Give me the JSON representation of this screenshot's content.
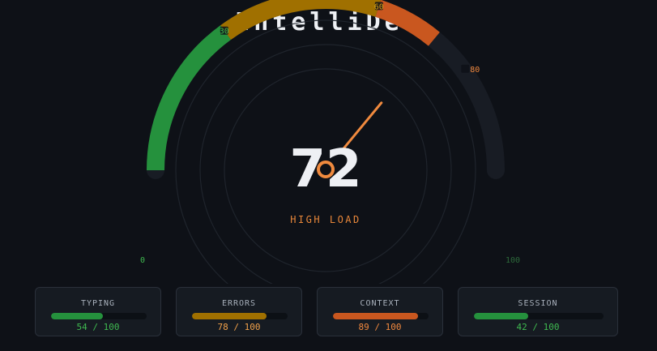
{
  "app": {
    "title": "IntelliDev"
  },
  "gauge": {
    "value": 72,
    "display_value": "72",
    "status": "HIGH LOAD",
    "min": 0,
    "max": 100,
    "labels": [
      "0",
      "30",
      "60",
      "80",
      "100"
    ],
    "zones": [
      {
        "from": 0,
        "to": 30,
        "color": "#25913d"
      },
      {
        "from": 30,
        "to": 60,
        "color": "#a07000"
      },
      {
        "from": 60,
        "to": 72,
        "color": "#c9571f"
      }
    ],
    "track_color": "#181c24",
    "needle_color": "#f08a3e"
  },
  "cards": [
    {
      "label": "TYPING",
      "value": 54,
      "max": 100,
      "value_text": "54 / 100",
      "color": "#25913d",
      "text_color": "#3fb950"
    },
    {
      "label": "ERRORS",
      "value": 78,
      "max": 100,
      "value_text": "78 / 100",
      "color": "#a07000",
      "text_color": "#f0a04a"
    },
    {
      "label": "CONTEXT",
      "value": 89,
      "max": 100,
      "value_text": "89 / 100",
      "color": "#c9571f",
      "text_color": "#f0883e"
    },
    {
      "label": "SESSION",
      "value": 42,
      "max": 100,
      "value_text": "42 / 100",
      "color": "#25913d",
      "text_color": "#3fb950"
    }
  ]
}
